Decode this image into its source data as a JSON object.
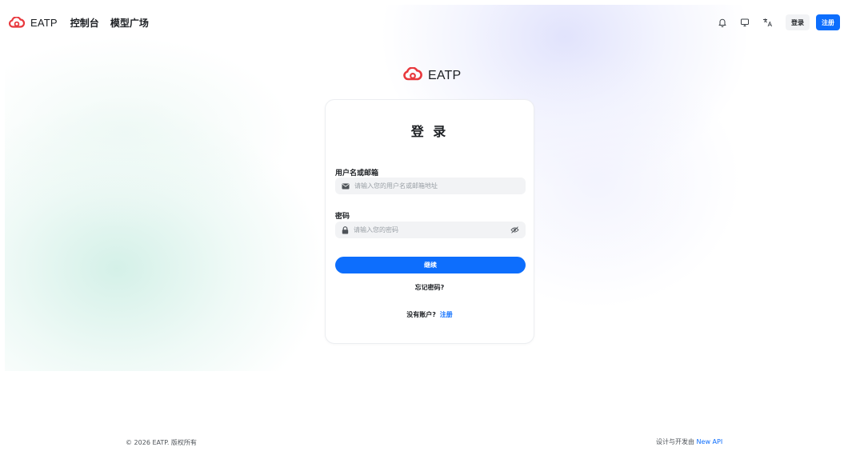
{
  "brand": {
    "name": "EATP",
    "logo_color": "#e8383d",
    "logo_icon": "cloud-logo-icon"
  },
  "nav": {
    "links": [
      "控制台",
      "模型广场"
    ],
    "icons": [
      "bell-icon",
      "monitor-icon",
      "translate-icon"
    ],
    "login_label": "登录",
    "register_label": "注册"
  },
  "login_card": {
    "title": "登 录",
    "username_label": "用户名或邮箱",
    "username_placeholder": "请输入您的用户名或邮箱地址",
    "username_icon": "mail-icon",
    "password_label": "密码",
    "password_placeholder": "请输入您的密码",
    "password_icon": "lock-icon",
    "toggle_icon": "eye-off-icon",
    "continue_label": "继续",
    "forgot_label": "忘记密码?",
    "no_account_text": "没有账户?",
    "signup_link": "注册"
  },
  "footer": {
    "copyright": "© 2026 EATP. 版权所有",
    "credit_text": "设计与开发由",
    "credit_link": "New API"
  },
  "colors": {
    "primary": "#0d6efd",
    "text": "#1c1f23",
    "input_bg": "#f2f3f5"
  }
}
